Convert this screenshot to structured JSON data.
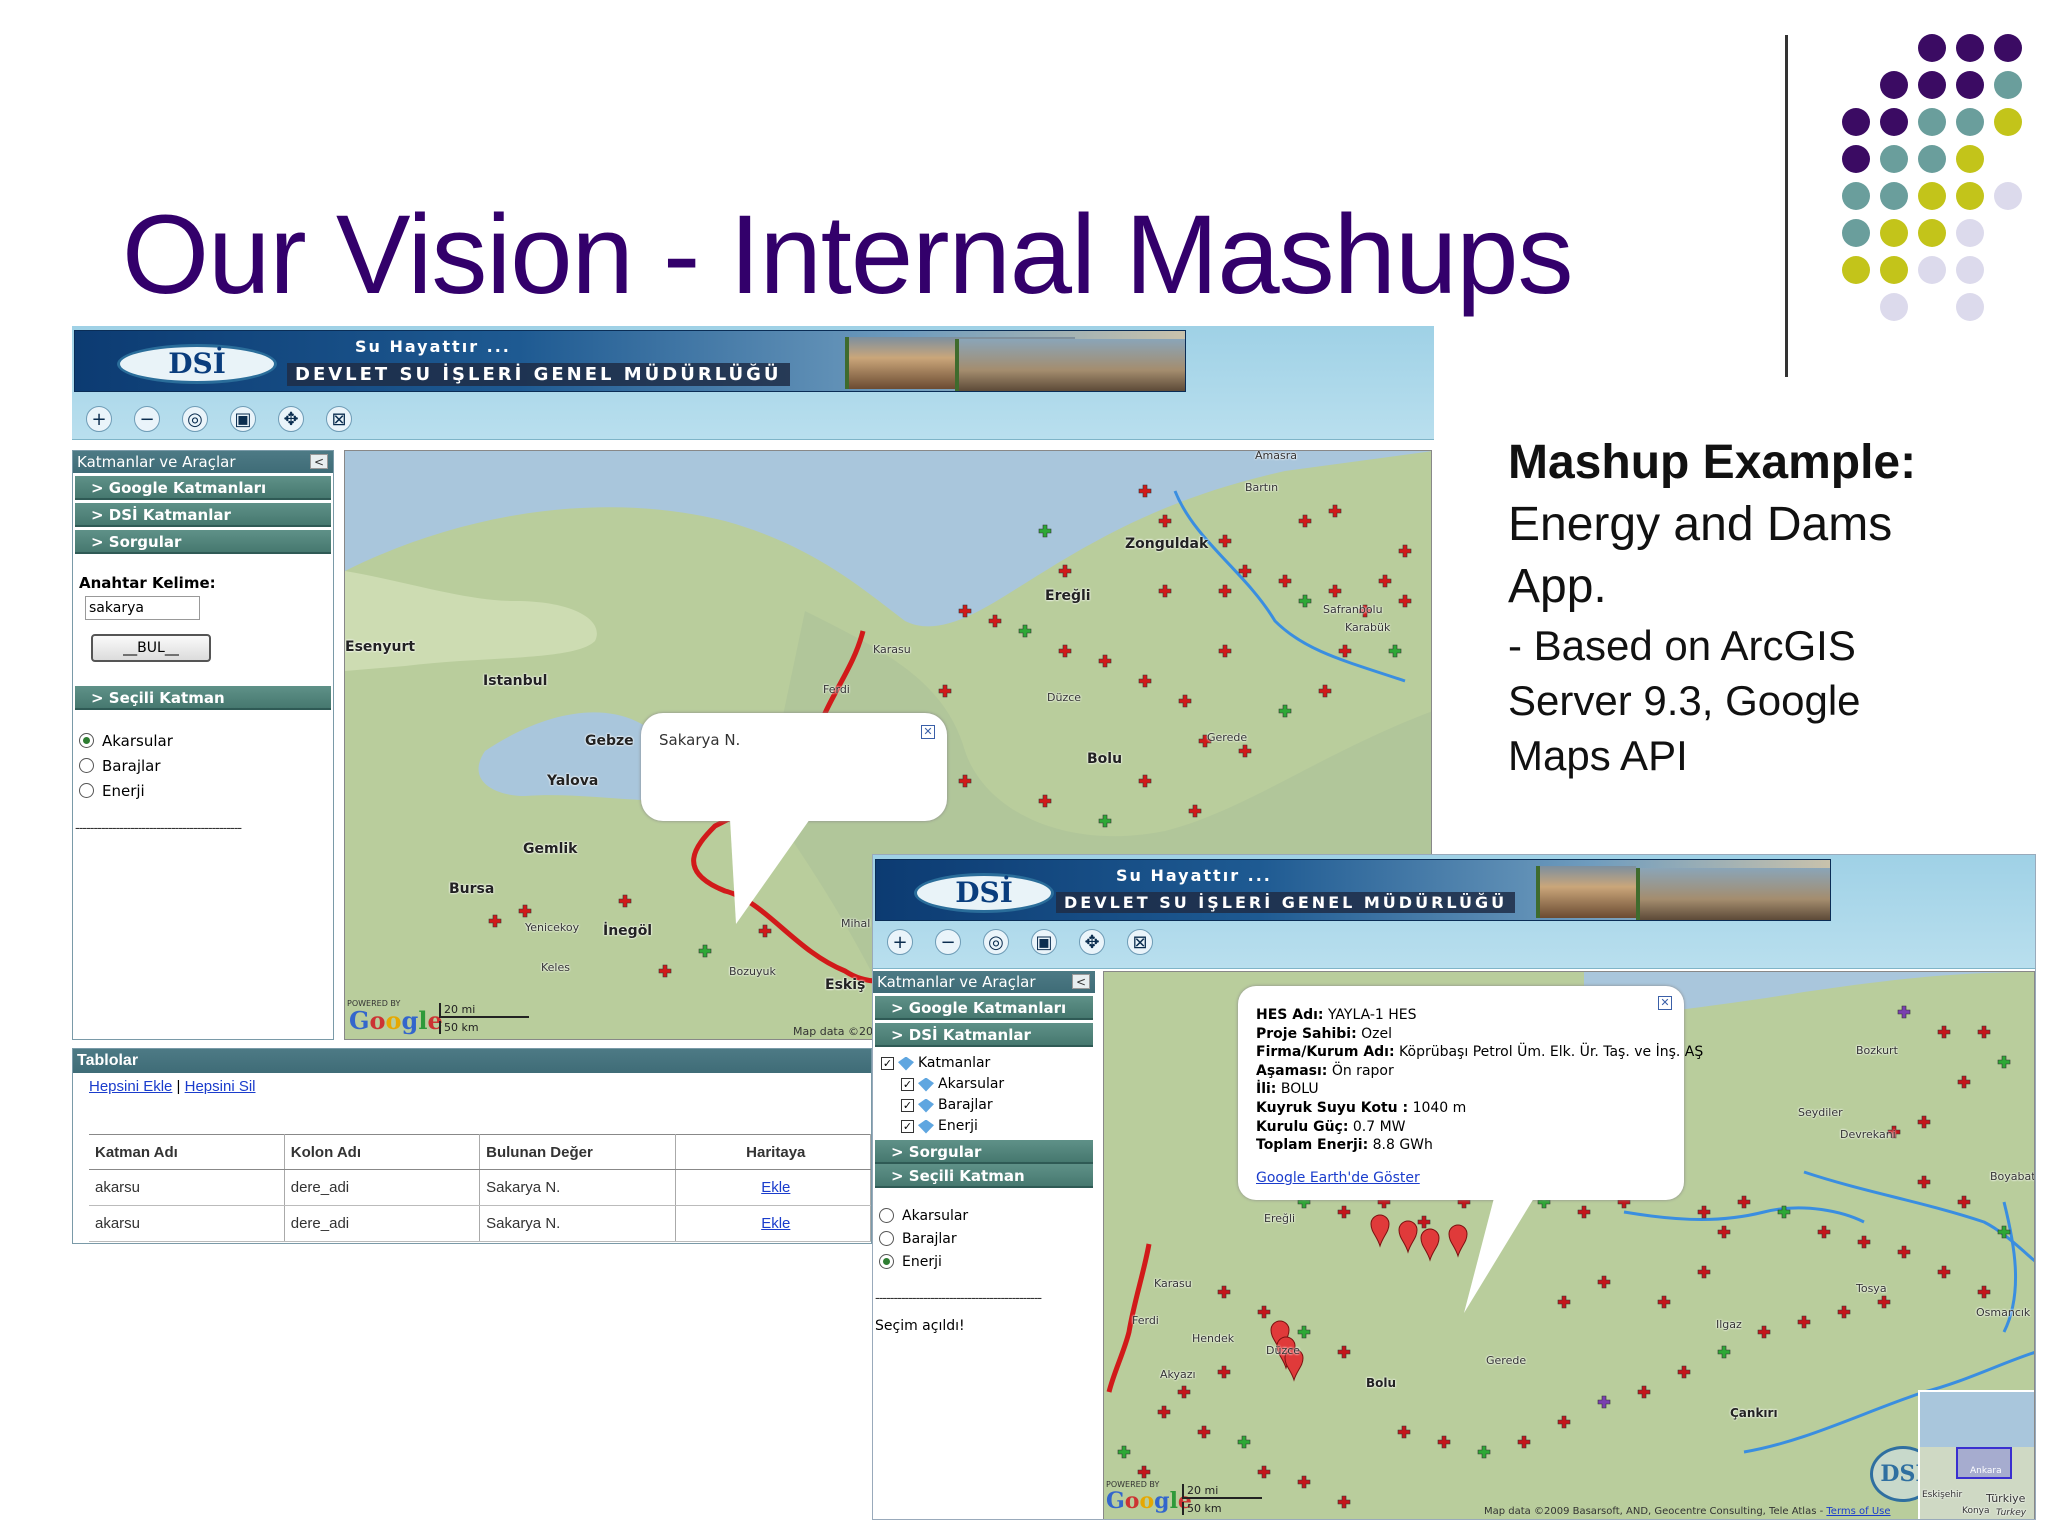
{
  "slide": {
    "title": "Our Vision - Internal Mashups",
    "mashup_heading": "Mashup Example:",
    "mashup_line1": "Energy and Dams",
    "mashup_line2": "App.",
    "mashup_sub1": "- Based on ArcGIS",
    "mashup_sub2": "Server 9.3, Google",
    "mashup_sub3": "Maps API",
    "dot_colors": [
      "#3b0b63",
      "#6a9e9c",
      "#c3c41a",
      "#dcdaec"
    ]
  },
  "app": {
    "banner_top": "Su Hayattır ...",
    "banner_main": "DEVLET SU İŞLERİ GENEL MÜDÜRLÜĞÜ",
    "logo_text": "DSİ",
    "tools": [
      "zoom-in-icon",
      "zoom-out-icon",
      "full-extent-icon",
      "zoom-box-icon",
      "pan-icon",
      "identify-icon"
    ],
    "panel_title": "Katmanlar ve Araçlar",
    "panel_close": "<",
    "acc_google": "> Google Katmanları",
    "acc_dsi": "> DSİ Katmanlar",
    "acc_sorgular": "> Sorgular",
    "acc_secili": "> Seçili Katman",
    "search_label": "Anahtar Kelime:",
    "search_value": "sakarya",
    "search_button": "__BUL__",
    "radios": [
      "Akarsular",
      "Barajlar",
      "Enerji"
    ],
    "dashes": "---------------------------------------------",
    "status_text": "Seçim açıldı!",
    "tree_root": "Katmanlar",
    "tree_items": [
      "Akarsular",
      "Barajlar",
      "Enerji"
    ]
  },
  "map1": {
    "labels": [
      "Amasra",
      "Bartın",
      "Zonguldak",
      "Ereğli",
      "Karasu",
      "Istanbul",
      "Esenyurt",
      "Gebze",
      "Yalova",
      "Gemlik",
      "Bursa",
      "Düzce",
      "Bolu",
      "Gerede",
      "İnegöl",
      "Yenicekoy",
      "Keles",
      "Bozuyuk",
      "Eskiş",
      "Mihal",
      "Ferdi",
      "Safranbolu",
      "Karabük"
    ],
    "popup_text": "Sakarya N.",
    "scale_mi": "20 mi",
    "scale_km": "50 km",
    "attrib": "Map data ©20",
    "powered": "POWERED BY"
  },
  "tablolar": {
    "title": "Tablolar",
    "link_add": "Hepsini Ekle",
    "separator": "|",
    "link_remove": "Hepsini Sil",
    "columns": [
      "Katman Adı",
      "Kolon Adı",
      "Bulunan Değer",
      "Haritaya"
    ],
    "rows": [
      [
        "akarsu",
        "dere_adi",
        "Sakarya N.",
        "Ekle"
      ],
      [
        "akarsu",
        "dere_adi",
        "Sakarya N.",
        "Ekle"
      ]
    ]
  },
  "map2": {
    "popup": [
      {
        "k": "HES Adı:",
        "v": "YAYLA-1 HES"
      },
      {
        "k": "Proje Sahibi:",
        "v": "Ozel"
      },
      {
        "k": "Firma/Kurum Adı:",
        "v": "Köprübaşı Petrol Üm. Elk. Ür. Taş. ve İnş. AŞ"
      },
      {
        "k": "Aşaması:",
        "v": "Ön rapor"
      },
      {
        "k": "İli:",
        "v": "BOLU"
      },
      {
        "k": "Kuyruk Suyu Kotu :",
        "v": "1040 m"
      },
      {
        "k": "Kurulu Güç:",
        "v": "0.7 MW"
      },
      {
        "k": "Toplam Enerji:",
        "v": "8.8 GWh"
      }
    ],
    "popup_link": "Google Earth'de Göster",
    "labels": [
      "Ereğli",
      "Karasu",
      "Hendek",
      "Düzce",
      "Akyazı",
      "Bolu",
      "Gerede",
      "Ilgaz",
      "Çankırı",
      "Tosya",
      "Osmancık",
      "Boyabat",
      "Devrekani",
      "Seydiler",
      "Bozkurt",
      "Ferdi"
    ],
    "scale_mi": "20 mi",
    "scale_km": "50 km",
    "attrib": "Map data ©2009 Basarsoft, AND, Geocentre Consulting, Tele Atlas -",
    "attrib_link": "Terms of Use",
    "inset_labels": [
      "Ankara",
      "Eskişehir",
      "Türkiye",
      "Konya",
      "Turkey"
    ],
    "powered": "POWERED BY",
    "logo_text": "DSİ"
  }
}
